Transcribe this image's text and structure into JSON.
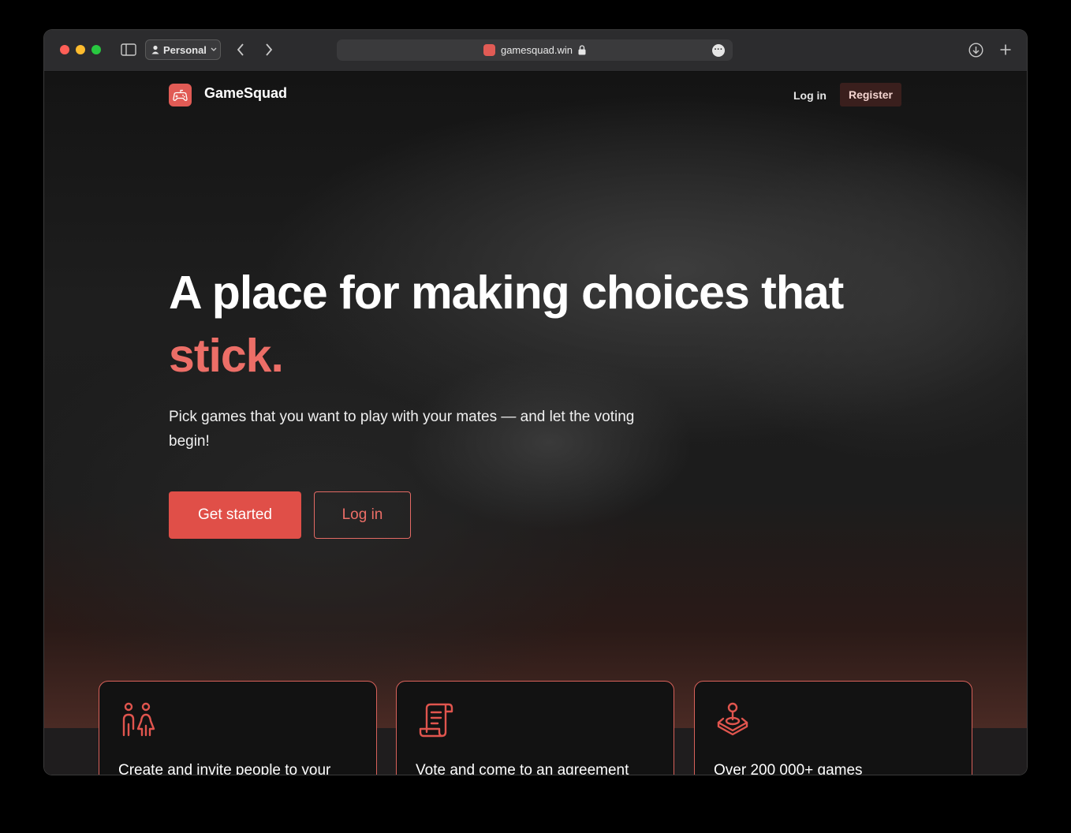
{
  "browser": {
    "profile_label": "Personal",
    "url": "gamesquad.win"
  },
  "nav": {
    "brand": "GameSquad",
    "login_label": "Log in",
    "register_label": "Register"
  },
  "hero": {
    "headline": "A place for making choices that",
    "headline_accent": "stick.",
    "subtitle": "Pick games that you want to play with your mates — and let the voting begin!",
    "primary_cta": "Get started",
    "secondary_cta": "Log in"
  },
  "features": [
    {
      "icon": "people-icon",
      "title": "Create and invite people to your"
    },
    {
      "icon": "document-icon",
      "title": "Vote and come to an agreement"
    },
    {
      "icon": "joystick-icon",
      "title": "Over 200 000+ games"
    }
  ],
  "colors": {
    "accent": "#e04f48",
    "accent_text": "#ec6e67",
    "background": "#161616"
  }
}
